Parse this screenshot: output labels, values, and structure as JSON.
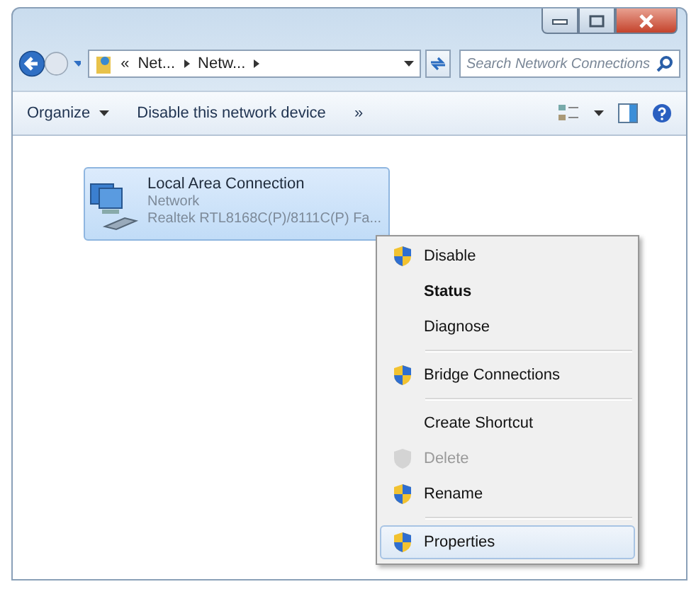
{
  "address_bar": {
    "crumbs": [
      "«",
      "Net...",
      "Netw..."
    ]
  },
  "search": {
    "placeholder": "Search Network Connections"
  },
  "toolbar": {
    "items": [
      {
        "label": "Organize",
        "dropdown": true
      },
      {
        "label": "Disable this network device",
        "dropdown": false
      },
      {
        "label": "»",
        "dropdown": false
      }
    ]
  },
  "connections": [
    {
      "name": "Local Area Connection",
      "network": "Network",
      "adapter": "Realtek RTL8168C(P)/8111C(P) Fa...",
      "selected": true
    }
  ],
  "context_menu": {
    "items": [
      {
        "kind": "item",
        "label": "Disable",
        "shield": true,
        "bold": false,
        "disabled": false,
        "selected": false
      },
      {
        "kind": "item",
        "label": "Status",
        "shield": false,
        "bold": true,
        "disabled": false,
        "selected": false
      },
      {
        "kind": "item",
        "label": "Diagnose",
        "shield": false,
        "bold": false,
        "disabled": false,
        "selected": false
      },
      {
        "kind": "separator"
      },
      {
        "kind": "item",
        "label": "Bridge Connections",
        "shield": true,
        "bold": false,
        "disabled": false,
        "selected": false
      },
      {
        "kind": "separator"
      },
      {
        "kind": "item",
        "label": "Create Shortcut",
        "shield": false,
        "bold": false,
        "disabled": false,
        "selected": false
      },
      {
        "kind": "item",
        "label": "Delete",
        "shield": true,
        "bold": false,
        "disabled": true,
        "selected": false
      },
      {
        "kind": "item",
        "label": "Rename",
        "shield": true,
        "bold": false,
        "disabled": false,
        "selected": false
      },
      {
        "kind": "separator"
      },
      {
        "kind": "item",
        "label": "Properties",
        "shield": true,
        "bold": false,
        "disabled": false,
        "selected": true
      }
    ]
  }
}
